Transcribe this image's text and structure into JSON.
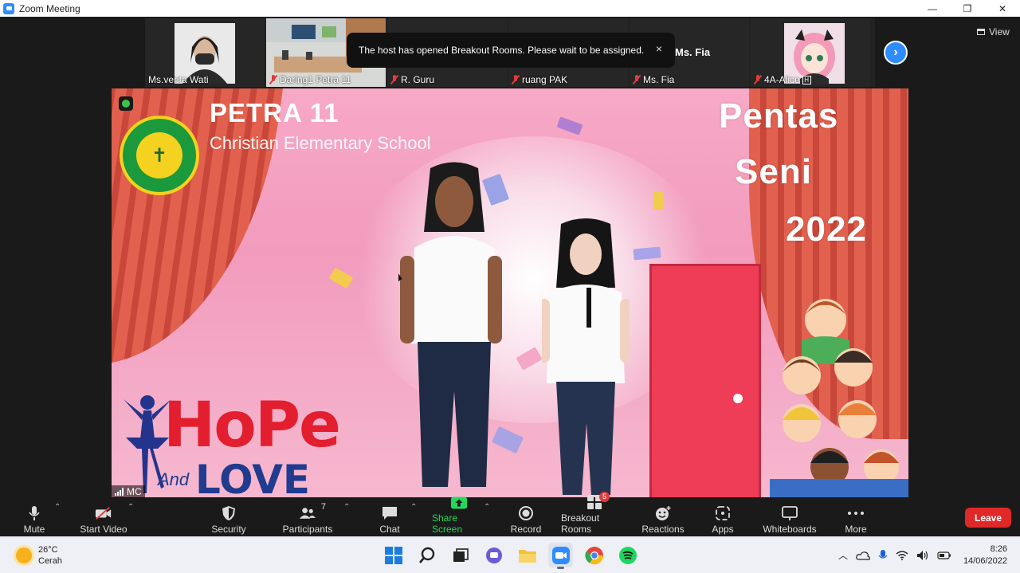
{
  "window": {
    "title": "Zoom Meeting",
    "controls": {
      "minimize": "—",
      "restore": "❐",
      "close": "✕"
    }
  },
  "gallery": {
    "tiles": [
      {
        "name": "Ms.venta Wati",
        "muted": false
      },
      {
        "name": "Daring1 Petra 11",
        "muted": true
      },
      {
        "name": "R. Guru",
        "muted": true
      },
      {
        "name": "ruang PAK",
        "muted": true
      },
      {
        "name": "Ms. Fia",
        "muted": true
      },
      {
        "name": "4A-Alice",
        "muted": true
      }
    ],
    "active_speaker_label": "Ms. Fia",
    "view_label": "View"
  },
  "notification": {
    "text": "The host has opened Breakout Rooms. Please wait to be assigned.",
    "close": "×"
  },
  "shared_screen": {
    "school_name": "PETRA 11",
    "school_subtitle": "Christian Elementary School",
    "logo_mark": "✝",
    "event_line1": "Pentas",
    "event_line2": "Seni",
    "event_year": "2022",
    "hope_text": "HoPe",
    "and_text": "And",
    "love_text": "LOVE",
    "presenter_label": "MC"
  },
  "toolbar": {
    "mute": "Mute",
    "start_video": "Start Video",
    "security": "Security",
    "participants": "Participants",
    "participants_count": "7",
    "chat": "Chat",
    "share_screen": "Share Screen",
    "record": "Record",
    "breakout_rooms": "Breakout Rooms",
    "breakout_count": "5",
    "reactions": "Reactions",
    "apps": "Apps",
    "whiteboards": "Whiteboards",
    "more": "More",
    "leave": "Leave"
  },
  "taskbar": {
    "temperature": "26°C",
    "condition": "Cerah",
    "time": "8:26",
    "date": "14/06/2022"
  },
  "colors": {
    "zoom_blue": "#2d8cff",
    "leave_red": "#e02828",
    "share_green": "#23d959",
    "toolbar_bg": "#1a1a1a"
  }
}
